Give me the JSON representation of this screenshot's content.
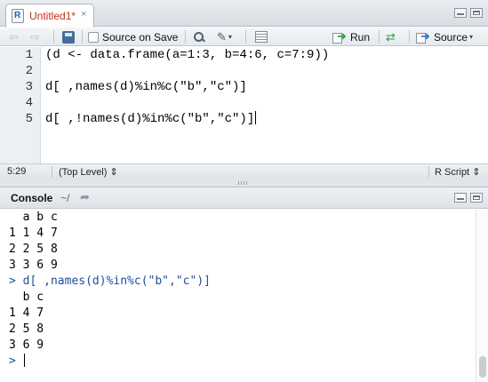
{
  "editor": {
    "tab": {
      "label": "Untitled1*",
      "close_glyph": "×",
      "file_icon_letter": "R"
    },
    "toolbar": {
      "source_on_save": "Source on Save",
      "run": "Run",
      "source": "Source"
    },
    "line_numbers": [
      "1",
      "2",
      "3",
      "4",
      "5"
    ],
    "code_lines": [
      "(d <- data.frame(a=1:3, b=4:6, c=7:9))",
      "",
      "d[ ,names(d)%in%c(\"b\",\"c\")]",
      "",
      "d[ ,!names(d)%in%c(\"b\",\"c\")]"
    ],
    "status": {
      "position": "5:29",
      "scope": "(Top Level)",
      "file_type": "R Script"
    }
  },
  "console": {
    "title": "Console",
    "path": "~/",
    "lines": [
      {
        "text": "  a b c",
        "kind": "output"
      },
      {
        "text": "1 1 4 7",
        "kind": "output"
      },
      {
        "text": "2 2 5 8",
        "kind": "output"
      },
      {
        "text": "3 3 6 9",
        "kind": "output"
      },
      {
        "text": "> d[ ,names(d)%in%c(\"b\",\"c\")]",
        "kind": "input"
      },
      {
        "text": "  b c",
        "kind": "output"
      },
      {
        "text": "1 4 7",
        "kind": "output"
      },
      {
        "text": "2 5 8",
        "kind": "output"
      },
      {
        "text": "3 6 9",
        "kind": "output"
      }
    ],
    "prompt": ">"
  },
  "colors": {
    "tab_modified": "#c0311b",
    "console_input": "#1f4f9f",
    "accent_green": "#2d9a3f"
  }
}
